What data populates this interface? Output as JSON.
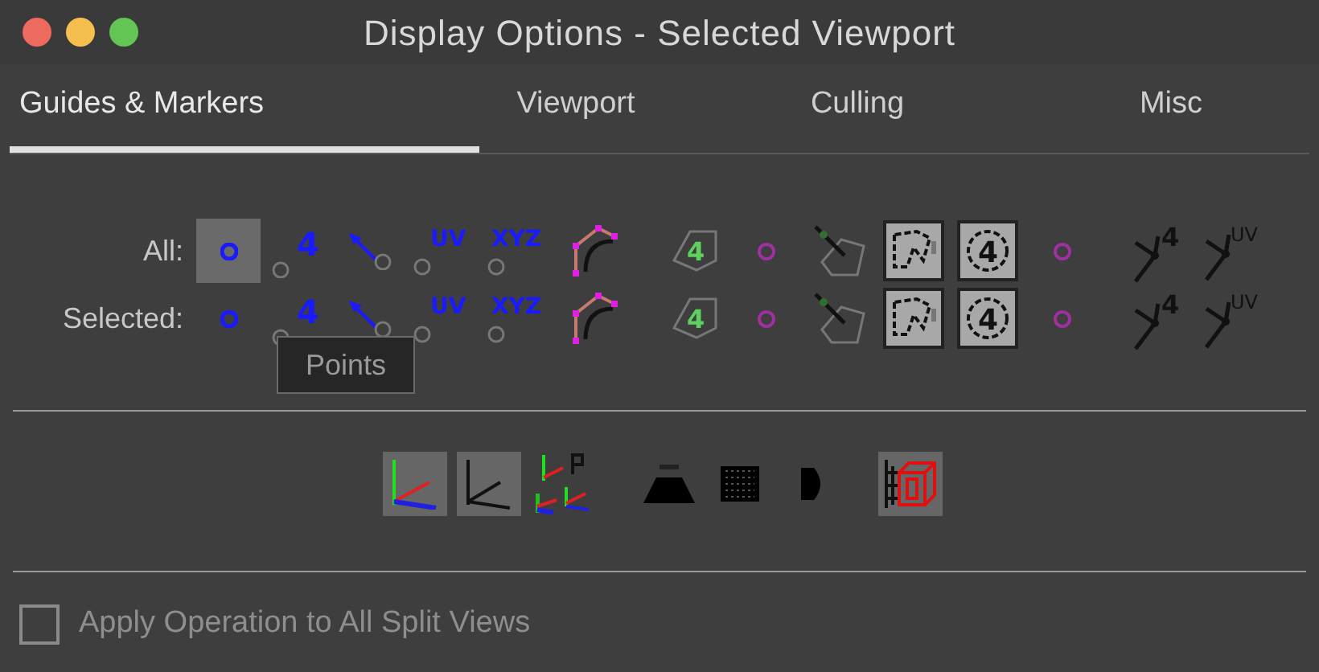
{
  "window": {
    "title": "Display Options - Selected Viewport"
  },
  "tabs": [
    {
      "label": "Guides & Markers",
      "selected": true
    },
    {
      "label": "Viewport",
      "selected": false
    },
    {
      "label": "Culling",
      "selected": false
    },
    {
      "label": "Misc",
      "selected": false
    }
  ],
  "marker_rows": [
    {
      "label": "All:",
      "toggles": [
        {
          "kind": "point",
          "highlighted": true
        },
        {
          "kind": "number",
          "text": "4",
          "highlighted": false
        },
        {
          "kind": "normal",
          "highlighted": false
        },
        {
          "kind": "uv",
          "text": "UV",
          "highlighted": false
        },
        {
          "kind": "xyz",
          "text": "XYZ",
          "highlighted": false
        },
        {
          "kind": "hull",
          "highlighted": false
        },
        {
          "kind": "face-number",
          "text": "4",
          "highlighted": false
        },
        {
          "kind": "prim-dot",
          "highlighted": false
        },
        {
          "kind": "prim-normal",
          "highlighted": false
        },
        {
          "kind": "outline-box",
          "highlighted": false
        },
        {
          "kind": "number-box",
          "text": "4",
          "highlighted": false
        },
        {
          "kind": "vertex-dot",
          "highlighted": false
        },
        {
          "kind": "vertex-number",
          "text": "4",
          "highlighted": false
        },
        {
          "kind": "vertex-uv",
          "text": "UV",
          "highlighted": false
        }
      ]
    },
    {
      "label": "Selected:",
      "toggles": [
        {
          "kind": "point",
          "highlighted": false
        },
        {
          "kind": "number",
          "text": "4",
          "highlighted": false
        },
        {
          "kind": "normal",
          "highlighted": false
        },
        {
          "kind": "uv",
          "text": "UV",
          "highlighted": false
        },
        {
          "kind": "xyz",
          "text": "XYZ",
          "highlighted": false
        },
        {
          "kind": "hull",
          "highlighted": false
        },
        {
          "kind": "face-number",
          "text": "4",
          "highlighted": false
        },
        {
          "kind": "prim-dot",
          "highlighted": false
        },
        {
          "kind": "prim-normal",
          "highlighted": false
        },
        {
          "kind": "outline-box",
          "highlighted": false
        },
        {
          "kind": "number-box",
          "text": "4",
          "highlighted": false
        },
        {
          "kind": "vertex-dot",
          "highlighted": false
        },
        {
          "kind": "vertex-number",
          "text": "4",
          "highlighted": false
        },
        {
          "kind": "vertex-uv",
          "text": "UV",
          "highlighted": false
        }
      ]
    }
  ],
  "tooltip": {
    "text": "Points"
  },
  "toolbar": [
    {
      "kind": "axes-color",
      "on": true
    },
    {
      "kind": "axes-plain",
      "on": true
    },
    {
      "kind": "axes-multi",
      "on": false
    },
    {
      "kind": "trapezoid",
      "on": false
    },
    {
      "kind": "grid",
      "on": false
    },
    {
      "kind": "half-disc",
      "on": false
    },
    {
      "kind": "cube",
      "on": true
    }
  ],
  "apply_option": {
    "label": "Apply Operation to All Split Views",
    "checked": false
  }
}
